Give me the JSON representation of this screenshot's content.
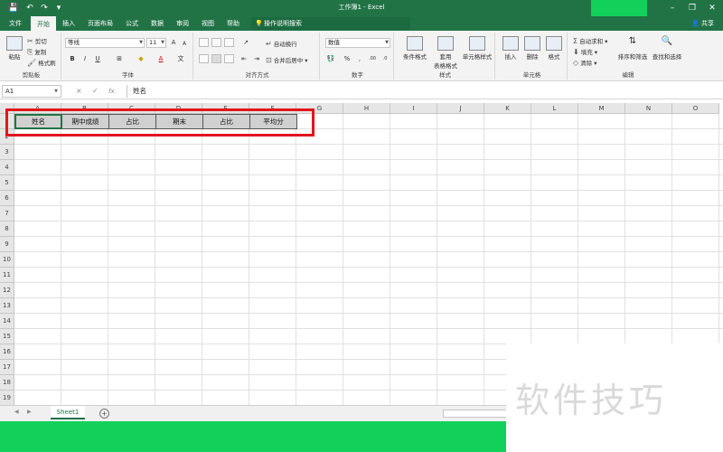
{
  "window": {
    "title": "工作簿1 - Excel",
    "share_label": "共享",
    "quick_access": [
      "save-icon",
      "undo-icon",
      "redo-icon",
      "customize-icon"
    ],
    "controls": [
      "minimize-icon",
      "restore-icon",
      "close-icon"
    ]
  },
  "tabs": [
    {
      "label": "文件"
    },
    {
      "label": "开始",
      "active": true
    },
    {
      "label": "插入"
    },
    {
      "label": "页面布局"
    },
    {
      "label": "公式"
    },
    {
      "label": "数据"
    },
    {
      "label": "审阅"
    },
    {
      "label": "视图"
    },
    {
      "label": "帮助"
    }
  ],
  "tell_me": {
    "placeholder": "操作说明搜索"
  },
  "ribbon": {
    "clipboard": {
      "label": "剪贴板",
      "paste": "粘贴",
      "cut": "剪切",
      "copy": "复制",
      "format_painter": "格式刷"
    },
    "font": {
      "label": "字体",
      "font_name": "等线",
      "font_size": "11",
      "bold": "B",
      "italic": "I",
      "underline": "U",
      "increase": "A",
      "decrease": "A"
    },
    "alignment": {
      "label": "对齐方式",
      "wrap_text": "自动换行",
      "merge_center": "合并后居中"
    },
    "number": {
      "label": "数字",
      "format": "数值",
      "percent": "%",
      "comma": ","
    },
    "styles": {
      "label": "样式",
      "conditional": "条件格式",
      "table_line1": "套用",
      "table_line2": "表格格式",
      "cell_styles": "单元格样式"
    },
    "cells": {
      "label": "单元格",
      "insert": "插入",
      "delete": "删除",
      "format": "格式"
    },
    "editing": {
      "label": "编辑",
      "autosum": "自动求和",
      "fill": "填充",
      "clear": "清除",
      "sort_filter": "排序和筛选",
      "find_select": "查找和选择"
    }
  },
  "formula_bar": {
    "name_box": "A1",
    "cancel": "×",
    "enter": "✓",
    "fx": "fx",
    "value": "姓名"
  },
  "grid": {
    "columns": [
      "A",
      "B",
      "C",
      "D",
      "E",
      "F",
      "G",
      "H",
      "I",
      "J",
      "K",
      "L",
      "M",
      "N",
      "O"
    ],
    "rows": [
      "1",
      "2",
      "3",
      "4",
      "5",
      "6",
      "7",
      "8",
      "9",
      "10",
      "11",
      "12",
      "13",
      "14",
      "15",
      "16",
      "17",
      "18",
      "19"
    ],
    "header_cells": [
      "姓名",
      "期中成绩",
      "占比",
      "期末",
      "占比",
      "平均分"
    ]
  },
  "sheets": [
    {
      "label": "Sheet1",
      "active": true
    }
  ],
  "watermark": "软件技巧",
  "colors": {
    "excel_green": "#217346",
    "highlight_red": "#e1161d",
    "header_fill": "#d0d0d0"
  }
}
